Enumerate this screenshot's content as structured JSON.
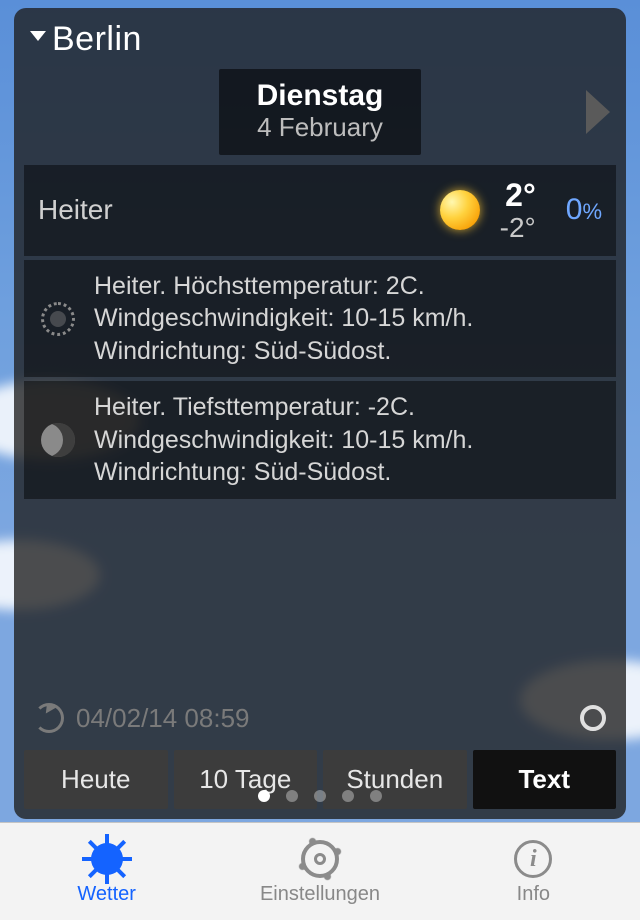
{
  "location": {
    "name": "Berlin"
  },
  "day_selector": {
    "day_name": "Dienstag",
    "date": "4 February"
  },
  "summary": {
    "condition": "Heiter",
    "icon": "sun",
    "high": "2°",
    "low": "-2°",
    "pop_value": "0",
    "pop_unit": "%"
  },
  "details": {
    "day": {
      "icon": "sun-outline",
      "text": "Heiter. Höchsttemperatur: 2C. Windgeschwindigkeit: 10-15 km/h. Windrichtung: Süd-Südost."
    },
    "night": {
      "icon": "moon",
      "text": "Heiter. Tiefsttemperatur: -2C. Windgeschwindigkeit: 10-15 km/h. Windrichtung: Süd-Südost."
    }
  },
  "refresh": {
    "timestamp": "04/02/14 08:59"
  },
  "tabs": {
    "today": "Heute",
    "tendays": "10 Tage",
    "hours": "Stunden",
    "text": "Text",
    "active": "text"
  },
  "pager": {
    "count": 5,
    "active": 0
  },
  "bottom": {
    "weather": "Wetter",
    "settings": "Einstellungen",
    "info": "Info",
    "active": "weather"
  }
}
